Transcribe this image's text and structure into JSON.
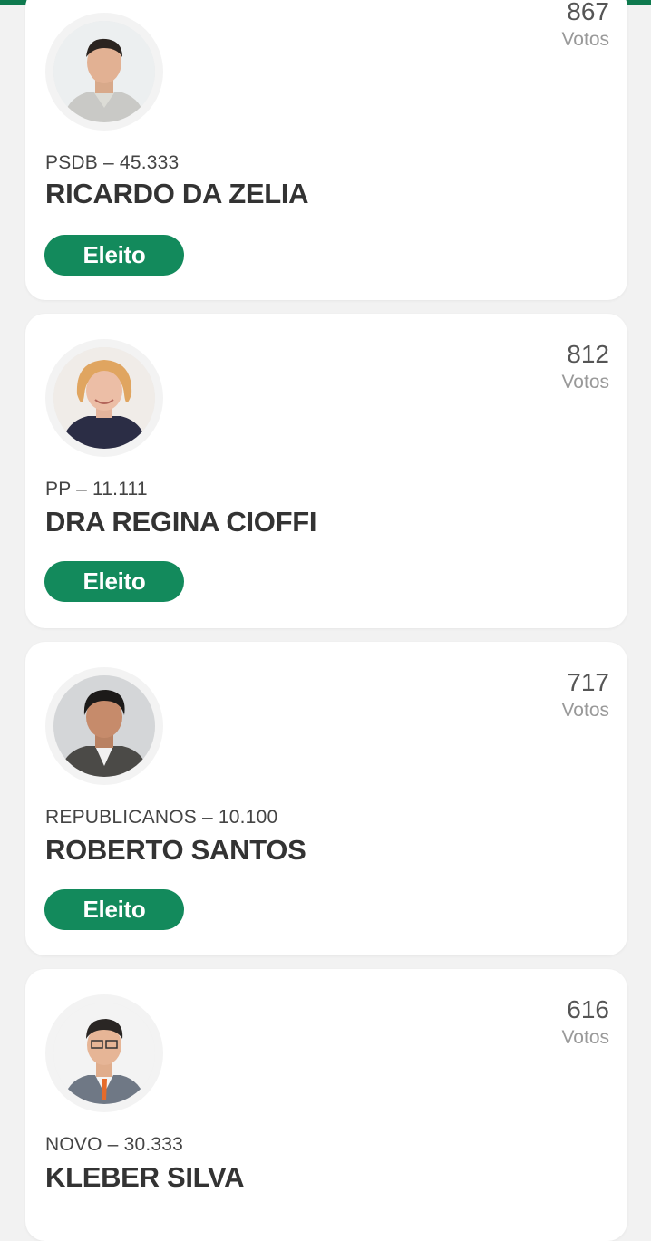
{
  "accent_color": "#138a5c",
  "votes_label": "Votos",
  "candidates": [
    {
      "party_number": "PSDB – 45.333",
      "name": "RICARDO DA ZELIA",
      "votes": "867",
      "status": "Eleito"
    },
    {
      "party_number": "PP – 11.111",
      "name": "DRA REGINA CIOFFI",
      "votes": "812",
      "status": "Eleito"
    },
    {
      "party_number": "REPUBLICANOS – 10.100",
      "name": "ROBERTO SANTOS",
      "votes": "717",
      "status": "Eleito"
    },
    {
      "party_number": "NOVO – 30.333",
      "name": "KLEBER SILVA",
      "votes": "616"
    }
  ]
}
